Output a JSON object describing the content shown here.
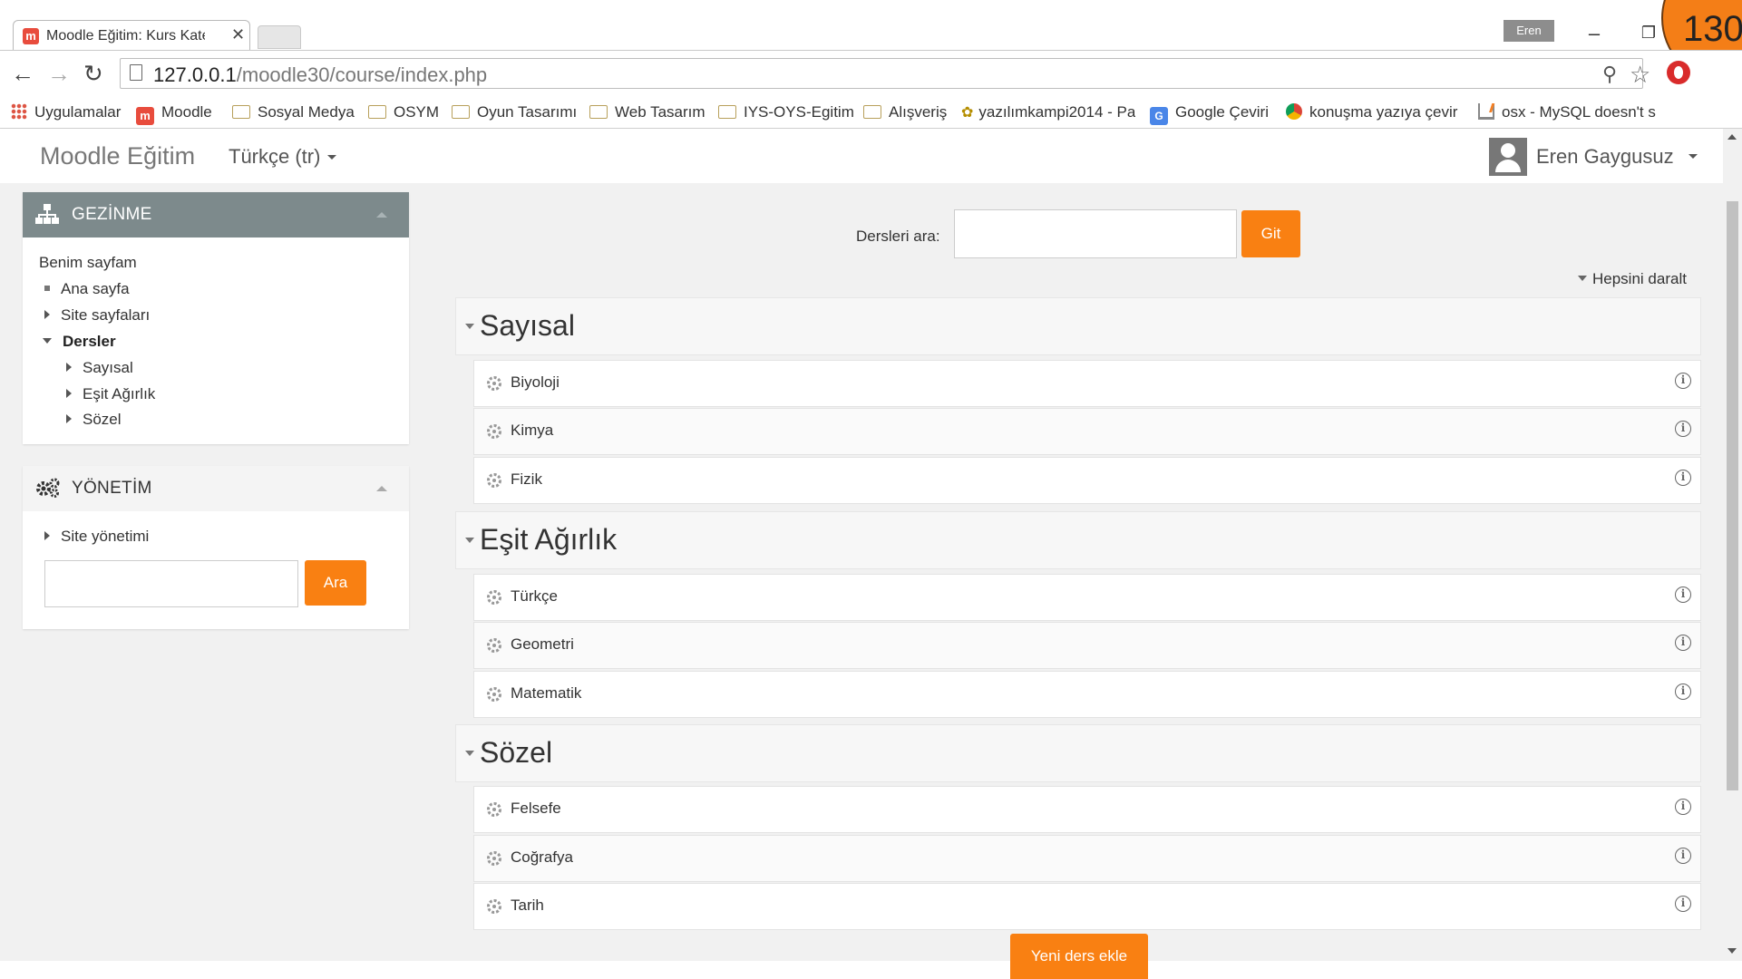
{
  "browser": {
    "tab_title": "Moodle Eğitim: Kurs Kateg",
    "tab_favicon": "m",
    "profile_badge": "Eren",
    "slide_number": "130",
    "url_host": "127.0.0.1",
    "url_path": "/moodle30/course/index.php",
    "bookmarks": [
      {
        "label": "Uygulamalar",
        "icon": "apps-icon"
      },
      {
        "label": "Moodle",
        "icon": "moodle-icon"
      },
      {
        "label": "Sosyal Medya",
        "icon": "folder-icon"
      },
      {
        "label": "OSYM",
        "icon": "folder-icon"
      },
      {
        "label": "Oyun Tasarımı",
        "icon": "folder-icon"
      },
      {
        "label": "Web Tasarım",
        "icon": "folder-icon"
      },
      {
        "label": "IYS-OYS-Egitim",
        "icon": "folder-icon"
      },
      {
        "label": "Alışveriş",
        "icon": "folder-icon"
      },
      {
        "label": "yazılımkampi2014 - Pa",
        "icon": "cat-icon"
      },
      {
        "label": "Google Çeviri",
        "icon": "google-translate-icon"
      },
      {
        "label": "konuşma yazıya çevir",
        "icon": "chrome-icon"
      },
      {
        "label": "osx - MySQL doesn't s",
        "icon": "stackoverflow-icon"
      }
    ]
  },
  "site": {
    "brand": "Moodle Eğitim",
    "language": "Türkçe (tr)",
    "user_name": "Eren Gaygusuz"
  },
  "navigation_block": {
    "title": "GEZİNME",
    "items": [
      {
        "label": "Benim sayfam"
      },
      {
        "label": "Ana sayfa"
      },
      {
        "label": "Site sayfaları"
      },
      {
        "label": "Dersler"
      },
      {
        "label": "Sayısal"
      },
      {
        "label": "Eşit Ağırlık"
      },
      {
        "label": "Sözel"
      }
    ]
  },
  "admin_block": {
    "title": "YÖNETİM",
    "items": [
      {
        "label": "Site yönetimi"
      }
    ],
    "search_button": "Ara",
    "search_value": ""
  },
  "course_search": {
    "label": "Dersleri ara:",
    "value": "",
    "button": "Git"
  },
  "collapse_all": "Hepsini daralt",
  "categories": [
    {
      "name": "Sayısal",
      "courses": [
        "Biyoloji",
        "Kimya",
        "Fizik"
      ]
    },
    {
      "name": "Eşit Ağırlık",
      "courses": [
        "Türkçe",
        "Geometri",
        "Matematik"
      ]
    },
    {
      "name": "Sözel",
      "courses": [
        "Felsefe",
        "Coğrafya",
        "Tarih"
      ]
    }
  ],
  "add_course_button": "Yeni ders ekle",
  "colors": {
    "accent_orange": "#f98012",
    "nav_header": "#7d8a8c",
    "page_bg": "#f1f1f1"
  }
}
